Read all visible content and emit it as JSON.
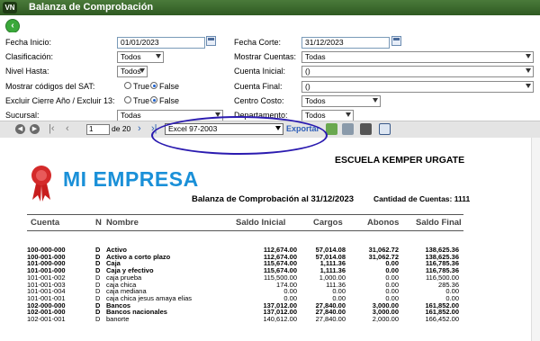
{
  "window": {
    "logo_text": "VN",
    "title": "Balanza de Comprobación"
  },
  "params": {
    "fecha_inicio_label": "Fecha Inicio:",
    "fecha_inicio_value": "01/01/2023",
    "fecha_corte_label": "Fecha Corte:",
    "fecha_corte_value": "31/12/2023",
    "clasificacion_label": "Clasificación:",
    "clasificacion_value": "Todos",
    "mostrar_cuentas_label": "Mostrar Cuentas:",
    "mostrar_cuentas_value": "Todas",
    "nivel_hasta_label": "Nivel Hasta:",
    "nivel_hasta_value": "Todos",
    "cuenta_inicial_label": "Cuenta Inicial:",
    "cuenta_inicial_value": "()",
    "mostrar_sat_label": "Mostrar códigos del SAT:",
    "mostrar_sat_true": "True",
    "mostrar_sat_false": "False",
    "cuenta_final_label": "Cuenta Final:",
    "cuenta_final_value": "()",
    "excluir_label": "Excluir Cierre Año / Excluir 13:",
    "excluir_true": "True",
    "excluir_false": "False",
    "centro_costo_label": "Centro Costo:",
    "centro_costo_value": "Todos",
    "sucursal_label": "Sucursal:",
    "sucursal_value": "Todas",
    "departamento_label": "Departamento:",
    "departamento_value": "Todos"
  },
  "toolbar": {
    "page": "1",
    "of_pages": "de 20",
    "format": "Excel 97-2003",
    "export_label": "Exportar"
  },
  "report": {
    "empresa": "MI EMPRESA",
    "school": "ESCUELA KEMPER URGATE",
    "title": "Balanza de Comprobación al 31/12/2023",
    "count": "Cantidad de Cuentas: 1111",
    "headers": {
      "cuenta": "Cuenta",
      "n": "N",
      "nombre": "Nombre",
      "saldo_inicial": "Saldo Inicial",
      "cargos": "Cargos",
      "abonos": "Abonos",
      "saldo_final": "Saldo Final"
    },
    "rows": [
      {
        "cuenta": "100-000-000",
        "n": "D",
        "nombre": "Activo",
        "si": "112,674.00",
        "cargos": "57,014.08",
        "abonos": "31,062.72",
        "sf": "138,625.36",
        "bold": true
      },
      {
        "cuenta": "100-001-000",
        "n": "D",
        "nombre": "Activo a corto plazo",
        "si": "112,674.00",
        "cargos": "57,014.08",
        "abonos": "31,062.72",
        "sf": "138,625.36",
        "bold": true
      },
      {
        "cuenta": "101-000-000",
        "n": "D",
        "nombre": "Caja",
        "si": "115,674.00",
        "cargos": "1,111.36",
        "abonos": "0.00",
        "sf": "116,785.36",
        "bold": true
      },
      {
        "cuenta": "101-001-000",
        "n": "D",
        "nombre": "Caja y efectivo",
        "si": "115,674.00",
        "cargos": "1,111.36",
        "abonos": "0.00",
        "sf": "116,785.36",
        "bold": true
      },
      {
        "cuenta": "101-001-002",
        "n": "D",
        "nombre": "caja prueba",
        "si": "115,500.00",
        "cargos": "1,000.00",
        "abonos": "0.00",
        "sf": "116,500.00",
        "bold": false
      },
      {
        "cuenta": "101-001-003",
        "n": "D",
        "nombre": "caja chica",
        "si": "174.00",
        "cargos": "111.36",
        "abonos": "0.00",
        "sf": "285.36",
        "bold": false
      },
      {
        "cuenta": "101-001-004",
        "n": "D",
        "nombre": "caja mediana",
        "si": "0.00",
        "cargos": "0.00",
        "abonos": "0.00",
        "sf": "0.00",
        "bold": false
      },
      {
        "cuenta": "101-001-001",
        "n": "D",
        "nombre": "caja chica jesus amaya elias",
        "si": "0.00",
        "cargos": "0.00",
        "abonos": "0.00",
        "sf": "0.00",
        "bold": false
      },
      {
        "cuenta": "102-000-000",
        "n": "D",
        "nombre": "Bancos",
        "si": "137,012.00",
        "cargos": "27,840.00",
        "abonos": "3,000.00",
        "sf": "161,852.00",
        "bold": true
      },
      {
        "cuenta": "102-001-000",
        "n": "D",
        "nombre": "Bancos nacionales",
        "si": "137,012.00",
        "cargos": "27,840.00",
        "abonos": "3,000.00",
        "sf": "161,852.00",
        "bold": true
      },
      {
        "cuenta": "102-001-001",
        "n": "D",
        "nombre": "banorte",
        "si": "140,612.00",
        "cargos": "27,840.00",
        "abonos": "2,000.00",
        "sf": "166,452.00",
        "bold": false
      }
    ]
  },
  "colors": {
    "titlebar": "#3b6a2c",
    "empresa": "#1a90d8",
    "annotation": "#2b1bb0",
    "export_link": "#2e5fb8"
  }
}
